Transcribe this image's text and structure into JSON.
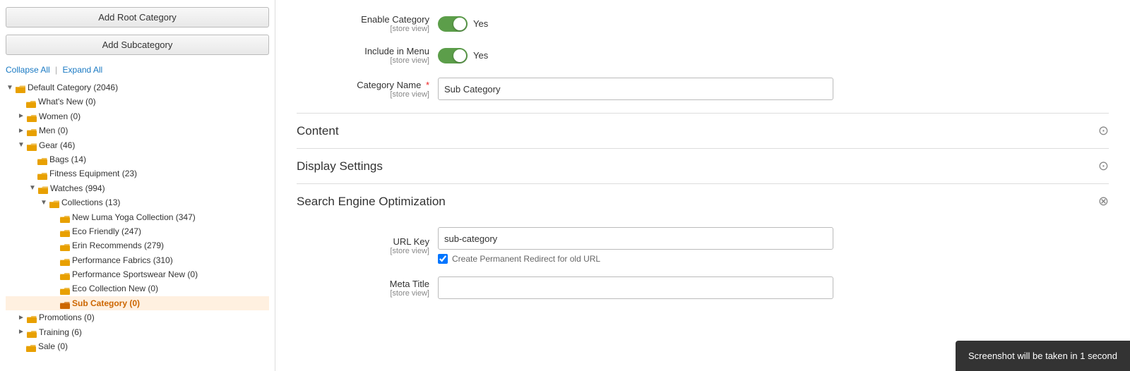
{
  "buttons": {
    "add_root": "Add Root Category",
    "add_sub": "Add Subcategory"
  },
  "tree_controls": {
    "collapse": "Collapse All",
    "divider": "|",
    "expand": "Expand All"
  },
  "tree": {
    "items": [
      {
        "level": 0,
        "label": "Default Category (2046)",
        "expanded": true,
        "selected": false,
        "has_expand": true,
        "expand_open": true
      },
      {
        "level": 1,
        "label": "What's New (0)",
        "expanded": false,
        "selected": false,
        "has_expand": false
      },
      {
        "level": 1,
        "label": "Women (0)",
        "expanded": false,
        "selected": false,
        "has_expand": true,
        "expand_open": false
      },
      {
        "level": 1,
        "label": "Men (0)",
        "expanded": false,
        "selected": false,
        "has_expand": true,
        "expand_open": false
      },
      {
        "level": 1,
        "label": "Gear (46)",
        "expanded": true,
        "selected": false,
        "has_expand": true,
        "expand_open": true
      },
      {
        "level": 2,
        "label": "Bags (14)",
        "expanded": false,
        "selected": false,
        "has_expand": false
      },
      {
        "level": 2,
        "label": "Fitness Equipment (23)",
        "expanded": false,
        "selected": false,
        "has_expand": false
      },
      {
        "level": 2,
        "label": "Watches (994)",
        "expanded": true,
        "selected": false,
        "has_expand": true,
        "expand_open": true
      },
      {
        "level": 3,
        "label": "Collections (13)",
        "expanded": true,
        "selected": false,
        "has_expand": true,
        "expand_open": true
      },
      {
        "level": 4,
        "label": "New Luma Yoga Collection (347)",
        "expanded": false,
        "selected": false,
        "has_expand": false
      },
      {
        "level": 4,
        "label": "Eco Friendly (247)",
        "expanded": false,
        "selected": false,
        "has_expand": false
      },
      {
        "level": 4,
        "label": "Erin Recommends (279)",
        "expanded": false,
        "selected": false,
        "has_expand": false
      },
      {
        "level": 4,
        "label": "Performance Fabrics (310)",
        "expanded": false,
        "selected": false,
        "has_expand": false
      },
      {
        "level": 4,
        "label": "Performance Sportswear New (0)",
        "expanded": false,
        "selected": false,
        "has_expand": false
      },
      {
        "level": 4,
        "label": "Eco Collection New (0)",
        "expanded": false,
        "selected": false,
        "has_expand": false
      },
      {
        "level": 4,
        "label": "Sub Category (0)",
        "expanded": false,
        "selected": true,
        "has_expand": false
      },
      {
        "level": 1,
        "label": "Promotions (0)",
        "expanded": false,
        "selected": false,
        "has_expand": true,
        "expand_open": false
      },
      {
        "level": 1,
        "label": "Training (6)",
        "expanded": false,
        "selected": false,
        "has_expand": true,
        "expand_open": false
      },
      {
        "level": 1,
        "label": "Sale (0)",
        "expanded": false,
        "selected": false,
        "has_expand": false
      }
    ]
  },
  "form": {
    "enable_category": {
      "label": "Enable Category",
      "store_view": "[store view]",
      "value": true,
      "value_label": "Yes"
    },
    "include_menu": {
      "label": "Include in Menu",
      "store_view": "[store view]",
      "value": true,
      "value_label": "Yes"
    },
    "category_name": {
      "label": "Category Name",
      "store_view": "[store view]",
      "required": true,
      "value": "Sub Category"
    },
    "content_section": {
      "title": "Content",
      "expanded": true
    },
    "display_settings_section": {
      "title": "Display Settings",
      "expanded": true
    },
    "seo_section": {
      "title": "Search Engine Optimization",
      "expanded": false
    },
    "url_key": {
      "label": "URL Key",
      "store_view": "[store view]",
      "value": "sub-category"
    },
    "create_redirect": {
      "label": "Create Permanent Redirect for old URL",
      "checked": true
    },
    "meta_title": {
      "label": "Meta Title",
      "store_view": "[store view]",
      "value": ""
    }
  },
  "toast": {
    "message": "Screenshot will be taken in 1 second"
  }
}
